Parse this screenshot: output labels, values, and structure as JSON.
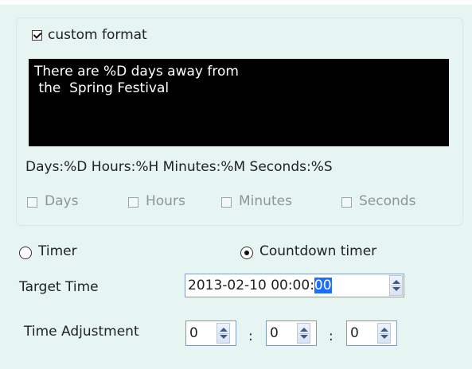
{
  "custom_format": {
    "label": "custom format",
    "checked": true
  },
  "editor": {
    "text": "There are %D days away from\n the  Spring Festival"
  },
  "format_hint": "Days:%D Hours:%H Minutes:%M Seconds:%S",
  "unit_options": [
    {
      "label": "Days",
      "checked": false,
      "enabled": false
    },
    {
      "label": "Hours",
      "checked": false,
      "enabled": false
    },
    {
      "label": "Minutes",
      "checked": false,
      "enabled": false
    },
    {
      "label": "Seconds",
      "checked": false,
      "enabled": false
    }
  ],
  "mode": {
    "timer_label": "Timer",
    "countdown_label": "Countdown timer",
    "selected": "Countdown timer"
  },
  "target_time": {
    "label": "Target Time",
    "value_prefix": "2013-02-10 00:00:",
    "value_selected": "00"
  },
  "time_adjustment": {
    "label": "Time Adjustment",
    "values": [
      "0",
      "0",
      "0"
    ],
    "separator": ":"
  },
  "colors": {
    "panel_bg": "#e6f4f2",
    "editor_bg": "#000000",
    "editor_fg": "#ffffff",
    "selection": "#1e6bff"
  }
}
